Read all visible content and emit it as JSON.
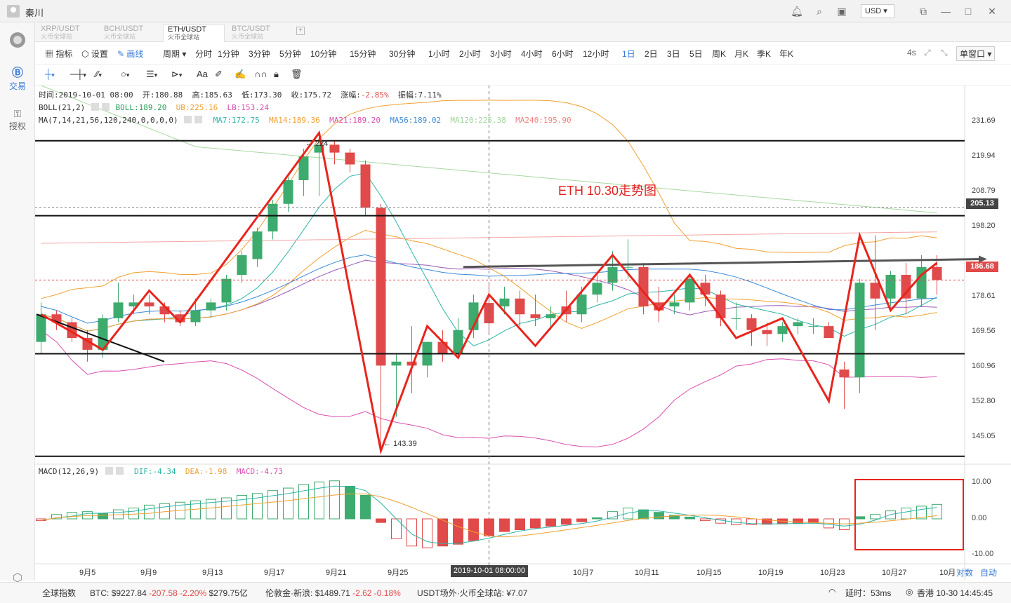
{
  "window": {
    "user": "秦川",
    "currency": "USD"
  },
  "sidebar": {
    "trade": "交易",
    "auth": "授权"
  },
  "tabs": [
    {
      "label": "XRP/USDT",
      "sub": "火币全球站"
    },
    {
      "label": "BCH/USDT",
      "sub": "火币全球站"
    },
    {
      "label": "ETH/USDT",
      "sub": "火币全球站",
      "active": true
    },
    {
      "label": "BTC/USDT",
      "sub": "火币全球站"
    }
  ],
  "toolbar": {
    "indicator": "指标",
    "settings": "设置",
    "draw": "画线",
    "period": "周期",
    "periods": [
      "分时",
      "1分钟",
      "3分钟",
      "5分钟",
      "10分钟",
      "15分钟",
      "30分钟",
      "1小时",
      "2小时",
      "3小时",
      "4小时",
      "6小时",
      "12小时",
      "1日",
      "2日",
      "3日",
      "5日",
      "周K",
      "月K",
      "季K",
      "年K"
    ],
    "selected_period": "1日",
    "refresh": "4s",
    "window_mode": "单窗口"
  },
  "info": {
    "time": "时间:2019-10-01 08:00",
    "open": "开:180.88",
    "high": "高:185.63",
    "low": "低:173.30",
    "close": "收:175.72",
    "change_label": "涨幅:",
    "change": "-2.85%",
    "amp": "振幅:7.11%",
    "boll_name": "BOLL(21,2)",
    "boll": "BOLL:189.20",
    "ub": "UB:225.16",
    "lb": "LB:153.24",
    "ma_name": "MA(7,14,21,56,120,240,0,0,0,0)",
    "ma7": "MA7:172.75",
    "ma14": "MA14:189.36",
    "ma21": "MA21:189.20",
    "ma56": "MA56:189.02",
    "ma120": "MA120:225.38",
    "ma240": "MA240:195.90"
  },
  "annotation": "ETH 10.30走势图",
  "macd": {
    "name": "MACD(12,26,9)",
    "dif": "DIF:-4.34",
    "dea": "DEA:-1.98",
    "macd": "MACD:-4.73"
  },
  "y_axis": [
    "231.69",
    "219.94",
    "208.79",
    "198.20",
    "178.61",
    "169.56",
    "160.96",
    "152.80",
    "145.05"
  ],
  "price_labels": {
    "level": "205.13",
    "current": "186.68",
    "peak": "← 224",
    "trough": "← 143.39"
  },
  "macd_axis": [
    "10.00",
    "0.00",
    "-10.00"
  ],
  "x_axis": [
    "9月5",
    "9月9",
    "9月13",
    "9月17",
    "9月21",
    "9月25",
    "10月7",
    "10月11",
    "10月15",
    "10月19",
    "10月23",
    "10月27",
    "10月"
  ],
  "crosshair_date": "2019-10-01 08:00:00",
  "axis_buttons": {
    "log": "对数",
    "auto": "自动"
  },
  "status": {
    "index": "全球指数",
    "btc_label": "BTC:",
    "btc_price": "$9227.84",
    "btc_chg": "-207.58 -2.20%",
    "btc_vol": "$279.75亿",
    "gold_label": "伦敦金·新浪:",
    "gold_price": "$1489.71",
    "gold_chg": "-2.62 -0.18%",
    "usdt": "USDT场外·火币全球站:",
    "usdt_price": "¥7.07",
    "latency": "延时：53ms",
    "clock": "香港 10-30 14:45:45"
  },
  "colors": {
    "up": "#3daa6e",
    "down": "#e04a4a",
    "annotation": "#e02020"
  },
  "chart_data": {
    "type": "candlestick",
    "categories": [
      "9-2",
      "9-3",
      "9-4",
      "9-5",
      "9-6",
      "9-7",
      "9-8",
      "9-9",
      "9-10",
      "9-11",
      "9-12",
      "9-13",
      "9-14",
      "9-15",
      "9-16",
      "9-17",
      "9-18",
      "9-19",
      "9-20",
      "9-21",
      "9-22",
      "9-23",
      "9-24",
      "9-25",
      "9-26",
      "9-27",
      "9-28",
      "9-29",
      "9-30",
      "10-1",
      "10-2",
      "10-3",
      "10-4",
      "10-5",
      "10-6",
      "10-7",
      "10-8",
      "10-9",
      "10-10",
      "10-11",
      "10-12",
      "10-13",
      "10-14",
      "10-15",
      "10-16",
      "10-17",
      "10-18",
      "10-19",
      "10-20",
      "10-21",
      "10-22",
      "10-23",
      "10-24",
      "10-25",
      "10-26",
      "10-27",
      "10-28",
      "10-29",
      "10-30"
    ],
    "open": [
      171,
      178,
      176,
      172,
      169,
      177,
      180,
      181,
      180,
      178,
      176,
      179,
      181,
      188,
      192,
      199,
      206,
      212,
      219,
      221,
      219,
      216,
      205,
      165,
      166,
      165,
      171,
      168,
      174,
      180.88,
      180,
      182,
      178,
      177,
      180,
      178,
      183,
      186,
      190,
      190,
      181,
      180,
      181,
      186,
      183,
      177,
      177,
      174,
      173,
      175,
      175,
      175,
      164,
      162,
      186,
      182,
      188,
      182,
      190
    ],
    "close": [
      178,
      176,
      172,
      169,
      177,
      181,
      181,
      180,
      178,
      176,
      179,
      181,
      187,
      193,
      199,
      206,
      212,
      218,
      221,
      219,
      216,
      205,
      165,
      166,
      165,
      171,
      168,
      174,
      181,
      175.72,
      182,
      178,
      177,
      178,
      178,
      183,
      186,
      190,
      190,
      180,
      179,
      181,
      187,
      183,
      177,
      177,
      174,
      173,
      175,
      176,
      175,
      172,
      162,
      186,
      182,
      188,
      182,
      190,
      186.68
    ],
    "high": [
      181,
      179,
      177,
      174,
      178,
      186,
      183,
      183,
      181,
      179,
      182,
      182,
      188,
      194,
      200,
      207,
      213,
      220,
      224,
      222,
      220,
      217,
      206,
      168,
      175,
      169,
      174,
      177,
      183,
      185.63,
      185,
      184,
      183,
      180,
      184,
      185,
      188,
      194,
      197,
      191,
      185,
      183,
      188,
      188,
      184,
      181,
      178,
      176,
      176,
      177,
      177,
      176,
      166,
      187,
      198,
      189,
      191,
      193,
      193
    ],
    "low": [
      168,
      174,
      171,
      166,
      167,
      176,
      178,
      178,
      176,
      175,
      175,
      177,
      179,
      186,
      190,
      197,
      204,
      208,
      208,
      216,
      214,
      203,
      143.39,
      152,
      158,
      162,
      166,
      167,
      172,
      173.3,
      178,
      175,
      175,
      174,
      176,
      176,
      181,
      184,
      187,
      178,
      176,
      178,
      179,
      180,
      175,
      174,
      170,
      170,
      171,
      173,
      173,
      172,
      154,
      158,
      174,
      180,
      178,
      180,
      183
    ],
    "ylim": [
      140,
      236
    ],
    "macd_values": [
      -0.5,
      1.2,
      1.8,
      2.0,
      1.5,
      2.5,
      3.0,
      3.8,
      4.2,
      4.6,
      5.0,
      5.4,
      5.8,
      6.5,
      7.0,
      7.8,
      8.5,
      9.5,
      10.2,
      10.5,
      9.0,
      6.5,
      -1.0,
      -5.5,
      -7.5,
      -8.0,
      -7.5,
      -7.0,
      -6.0,
      -4.73,
      -3.5,
      -3.0,
      -2.5,
      -2.0,
      -1.5,
      -0.8,
      0.3,
      2.0,
      3.0,
      2.5,
      1.8,
      1.0,
      0.5,
      -0.5,
      -1.2,
      -1.6,
      -1.6,
      -1.5,
      -1.4,
      -1.3,
      -1.2,
      -2.5,
      -3.0,
      0.6,
      1.2,
      2.2,
      3.0,
      3.5,
      4.0
    ],
    "macd_ylim": [
      -12,
      12
    ]
  }
}
